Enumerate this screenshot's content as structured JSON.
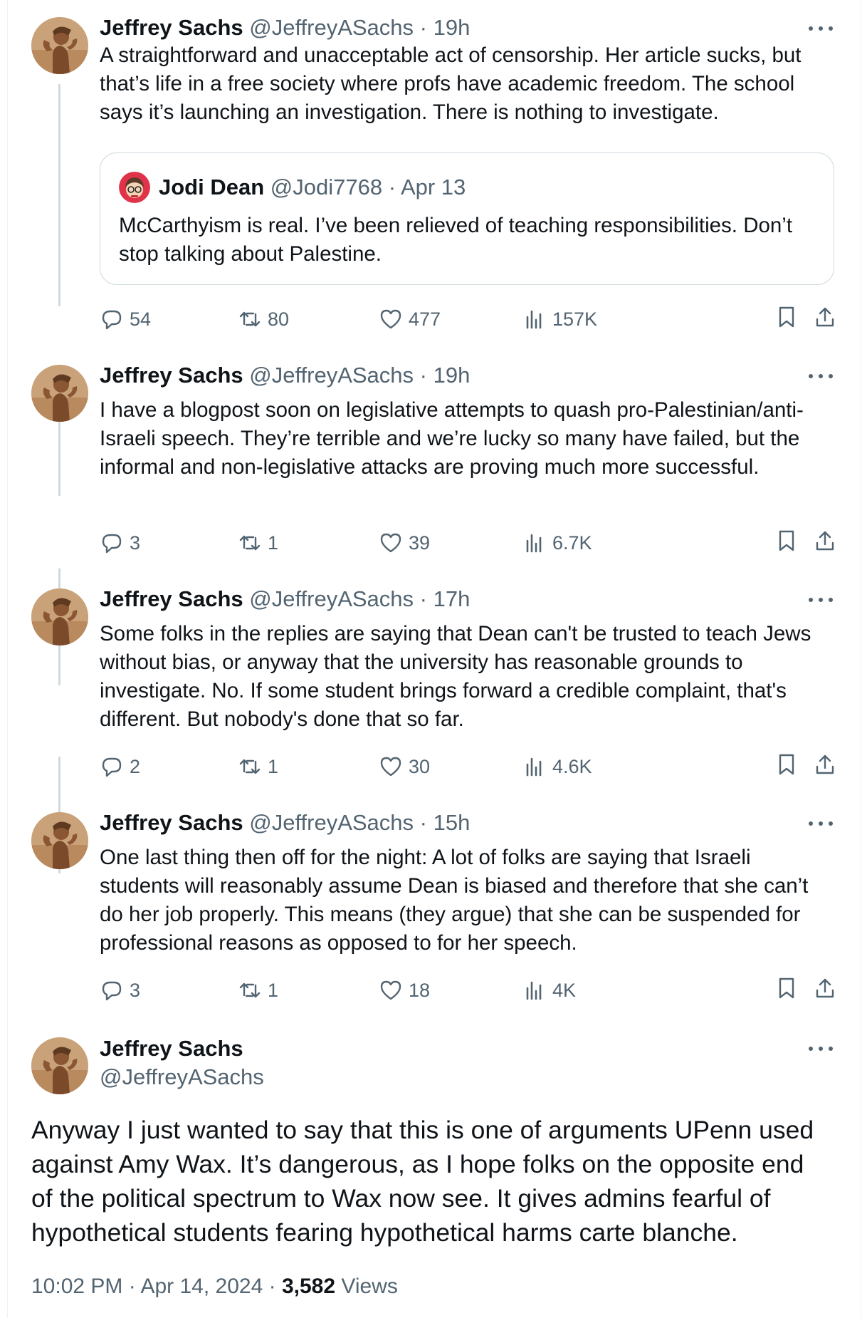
{
  "author": {
    "name": "Jeffrey Sachs",
    "handle": "@JeffreyASachs",
    "avatar_icon": "statue-avatar-icon"
  },
  "separator": "·",
  "tweets": [
    {
      "time": "19h",
      "text": "A straightforward and unacceptable act of censorship. Her article sucks, but that’s life in a free society where profs have academic freedom. The school says it’s launching an investigation. There is nothing to investigate.",
      "quote": {
        "name": "Jodi Dean",
        "handle": "@Jodi7768",
        "date": "Apr 13",
        "text": "McCarthyism is real. I’ve been relieved of teaching responsibilities. Don’t stop talking about Palestine."
      },
      "replies": "54",
      "retweets": "80",
      "likes": "477",
      "views": "157K"
    },
    {
      "time": "19h",
      "text": "I have a blogpost soon on legislative attempts to quash pro-Palestinian/anti-Israeli speech. They’re terrible and we’re lucky so many have failed, but the informal and non-legislative attacks are proving much more successful.",
      "replies": "3",
      "retweets": "1",
      "likes": "39",
      "views": "6.7K"
    },
    {
      "time": "17h",
      "text": "Some folks in the replies are saying that Dean can't be trusted to teach Jews without bias, or anyway that the university has reasonable grounds to investigate. No. If some student brings forward a credible complaint, that's different. But nobody's done that so far.",
      "replies": "2",
      "retweets": "1",
      "likes": "30",
      "views": "4.6K"
    },
    {
      "time": "15h",
      "text": "One last thing then off for the night: A lot of folks are saying that Israeli students will reasonably assume Dean is biased and therefore that she can’t do her job properly. This means (they argue) that she can be suspended for professional reasons as opposed to for her speech.",
      "replies": "3",
      "retweets": "1",
      "likes": "18",
      "views": "4K"
    }
  ],
  "main_tweet": {
    "text": "Anyway I just wanted to say that this is one of arguments UPenn used against Amy Wax. It’s dangerous, as I hope folks on the opposite end of the political spectrum to Wax now see. It gives admins fearful of hypothetical students fearing hypothetical harms carte blanche.",
    "time": "10:02 PM",
    "date": "Apr 14, 2024",
    "views_count": "3,582",
    "views_label": "Views"
  },
  "icons": [
    "reply-icon",
    "retweet-icon",
    "like-icon",
    "views-icon",
    "bookmark-icon",
    "share-icon",
    "more-icon"
  ],
  "colors": {
    "text": "#0f1419",
    "muted": "#536471",
    "border": "#cfd9de"
  }
}
